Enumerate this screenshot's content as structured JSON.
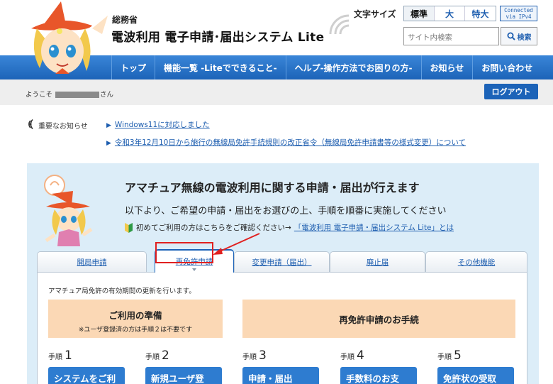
{
  "header": {
    "ministry": "総務省",
    "title": "電波利用 電子申請･届出システム Lite",
    "font_size_label": "文字サイズ",
    "font_sizes": [
      "標準",
      "大",
      "特大"
    ],
    "ipv4_badge_line1": "Connected",
    "ipv4_badge_line2": "via IPv4",
    "search_placeholder": "サイト内検索",
    "search_button": "検索"
  },
  "nav": {
    "items": [
      "トップ",
      "機能一覧 -Liteでできること-",
      "ヘルプ-操作方法でお困りの方-",
      "お知らせ",
      "お問い合わせ"
    ]
  },
  "welcome": {
    "prefix": "ようこそ",
    "suffix": "さん",
    "logout": "ログアウト"
  },
  "notices": {
    "label": "重要なお知らせ",
    "items": [
      "Windows11に対応しました",
      "令和3年12月10日から施行の無線局免許手続規則の改正省令（無線局免許申請書等の様式変更）について"
    ]
  },
  "main": {
    "title": "アマチュア無線の電波利用に関する申請・届出が行えます",
    "subtitle": "以下より、ご希望の申請・届出をお選びの上、手順を順番に実施してください",
    "first_time_text": "初めてご利用の方はこちらをご確認ください→",
    "first_time_link": "「電波利用 電子申請・届出システム Lite」とは",
    "tabs": [
      "開局申請",
      "再免許申請",
      "変更申請（届出）",
      "廃止届",
      "その他機能"
    ],
    "active_tab": 1,
    "description": "アマチュア局免許の有効期間の更新を行います。",
    "prep_title": "ご利用の準備",
    "prep_note": "※ユーザ登録済の方は手順２は不要です",
    "procedure_title": "再免許申請のお手続",
    "step_label": "手順",
    "steps": [
      {
        "num": "1",
        "button": "システムをご利"
      },
      {
        "num": "2",
        "button": "新規ユーザ登"
      },
      {
        "num": "3",
        "button": "申請・届出"
      },
      {
        "num": "4",
        "button": "手数料のお支"
      },
      {
        "num": "5",
        "button": "免許状の受取"
      }
    ]
  },
  "colors": {
    "brand_blue": "#1c63b8",
    "nav_gradient_top": "#3a86d8",
    "panel_bg": "#dcedf8",
    "step_header_bg": "#fbd8b5",
    "annotation_red": "#e02020"
  }
}
